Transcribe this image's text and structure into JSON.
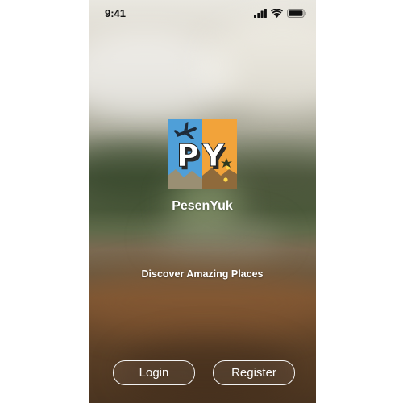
{
  "status_bar": {
    "time": "9:41",
    "icons": [
      "cellular-signal-icon",
      "wifi-icon",
      "battery-icon"
    ]
  },
  "logo": {
    "text": "PY",
    "colors": {
      "left_panel": "#4f9fd8",
      "right_panel": "#f2a33a",
      "letters": "#ffffff",
      "shadow": "#2b2b2b"
    }
  },
  "app": {
    "name": "PesenYuk",
    "tagline": "Discover Amazing Places"
  },
  "actions": {
    "login_label": "Login",
    "register_label": "Register"
  }
}
